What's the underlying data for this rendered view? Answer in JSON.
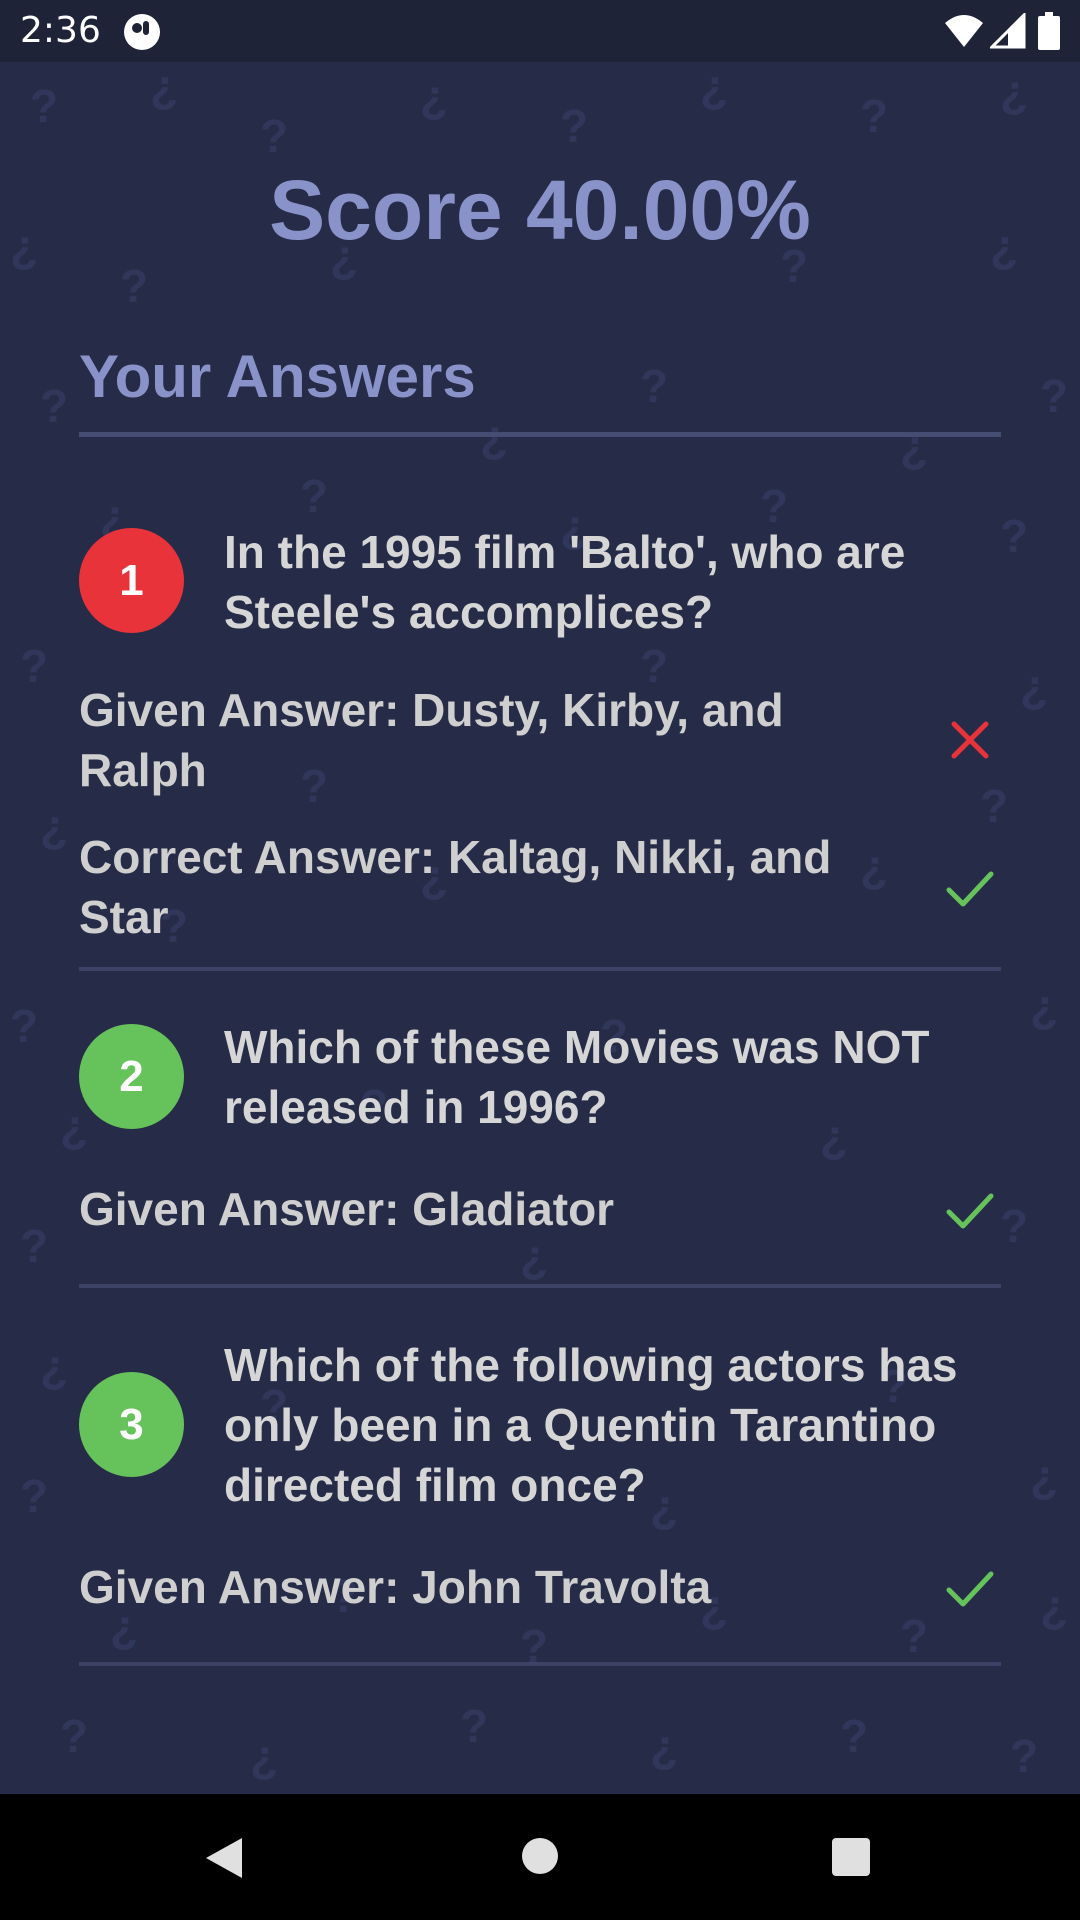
{
  "status_bar": {
    "time": "2:36",
    "icons": [
      "app-notification-icon",
      "wifi-icon",
      "cellular-signal-icon",
      "battery-icon"
    ]
  },
  "score": {
    "label": "Score 40.00%"
  },
  "answers_section": {
    "title": "Your Answers"
  },
  "questions": [
    {
      "number": "1",
      "status": "incorrect",
      "badge_color": "#e8333a",
      "question": "In the 1995 film 'Balto', who are Steele's accomplices?",
      "given_answer": "Given Answer: Dusty, Kirby, and Ralph",
      "given_icon": "cross-icon",
      "correct_answer": "Correct Answer: Kaltag, Nikki, and Star",
      "correct_icon": "check-icon"
    },
    {
      "number": "2",
      "status": "correct",
      "badge_color": "#66c25a",
      "question": "Which of these Movies was NOT released in 1996?",
      "given_answer": "Given Answer: Gladiator",
      "given_icon": "check-icon"
    },
    {
      "number": "3",
      "status": "correct",
      "badge_color": "#66c25a",
      "question": "Which of the following actors has only been in a Quentin Tarantino directed film once?",
      "given_answer": "Given Answer: John Travolta",
      "given_icon": "check-icon"
    }
  ],
  "colors": {
    "background": "#262c48",
    "accent_text": "#8a93c9",
    "correct": "#66c25a",
    "incorrect": "#e8333a"
  },
  "nav_bar": {
    "icons": [
      "back-icon",
      "home-icon",
      "recents-icon"
    ]
  }
}
